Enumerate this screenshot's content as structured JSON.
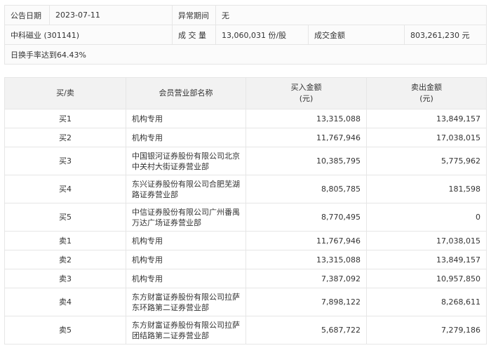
{
  "info": {
    "date_label": "公告日期",
    "date": "2023-07-11",
    "period_label": "异常期间",
    "period": "无",
    "stock": "中科磁业 (301141)",
    "volume_label": "成 交 量",
    "volume": "13,060,031 份/股",
    "amount_label": "成交金额",
    "amount": "803,261,230 元",
    "reason": "日换手率达到64.43%"
  },
  "table": {
    "headers": {
      "side": "买/卖",
      "name": "会员营业部名称",
      "buy": "买入金额",
      "buy_unit": "(元)",
      "sell": "卖出金额",
      "sell_unit": "(元)"
    },
    "rows": [
      {
        "side": "买1",
        "name": "机构专用",
        "buy": "13,315,088",
        "sell": "13,849,157"
      },
      {
        "side": "买2",
        "name": "机构专用",
        "buy": "11,767,946",
        "sell": "17,038,015"
      },
      {
        "side": "买3",
        "name": "中国银河证券股份有限公司北京中关村大街证券营业部",
        "buy": "10,385,795",
        "sell": "5,775,962"
      },
      {
        "side": "买4",
        "name": "东兴证券股份有限公司合肥芜湖路证券营业部",
        "buy": "8,805,785",
        "sell": "181,598"
      },
      {
        "side": "买5",
        "name": "中信证券股份有限公司广州番禺万达广场证券营业部",
        "buy": "8,770,495",
        "sell": "0"
      },
      {
        "side": "卖1",
        "name": "机构专用",
        "buy": "11,767,946",
        "sell": "17,038,015"
      },
      {
        "side": "卖2",
        "name": "机构专用",
        "buy": "13,315,088",
        "sell": "13,849,157"
      },
      {
        "side": "卖3",
        "name": "机构专用",
        "buy": "7,387,092",
        "sell": "10,957,850"
      },
      {
        "side": "卖4",
        "name": "东方财富证券股份有限公司拉萨东环路第二证券营业部",
        "buy": "7,898,122",
        "sell": "8,268,611"
      },
      {
        "side": "卖5",
        "name": "东方财富证券股份有限公司拉萨团结路第二证券营业部",
        "buy": "5,687,722",
        "sell": "7,279,186"
      }
    ]
  }
}
